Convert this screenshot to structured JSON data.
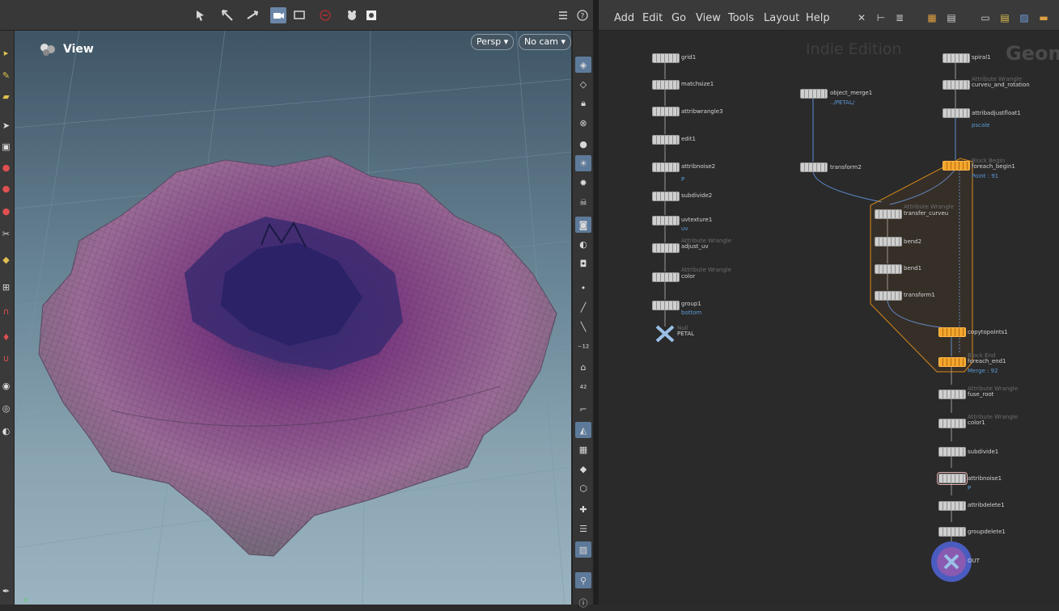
{
  "viewer": {
    "view_label": "View",
    "persp_button": "Persp",
    "cam_button": "No cam",
    "toolbar_icons": [
      "select-mode-icon",
      "handle-icon",
      "transform-icon",
      "camera-icon",
      "display-icon",
      "ghost-icon",
      "snapshot-icon",
      "render-icon"
    ],
    "axis_label": "y"
  },
  "network": {
    "menu": [
      "Add",
      "Edit",
      "Go",
      "View",
      "Tools",
      "Layout",
      "Help"
    ],
    "watermark_edition": "Indie Edition",
    "watermark_context": "Geom",
    "nodes": {
      "grid1": {
        "label": "grid1"
      },
      "matchsize1": {
        "label": "matchsize1"
      },
      "attribwrangle3": {
        "label": "attribwrangle3"
      },
      "edit1": {
        "label": "edit1"
      },
      "attribnoise2": {
        "label": "attribnoise2",
        "extra": "P"
      },
      "subdivide2": {
        "label": "subdivide2"
      },
      "uvtexture1": {
        "label": "uvtexture1",
        "extra": "uv"
      },
      "adjust_uv": {
        "type": "Attribute Wrangle",
        "label": "adjust_uv"
      },
      "color": {
        "type": "Attribute Wrangle",
        "label": "color"
      },
      "group1": {
        "label": "group1",
        "extra": "bottom"
      },
      "petal": {
        "type": "Null",
        "label": "PETAL"
      },
      "object_merge1": {
        "label": "object_merge1",
        "extra": "../PETAL/"
      },
      "transform2": {
        "label": "transform2"
      },
      "spiral1": {
        "label": "spiral1"
      },
      "curveu_and_rotation": {
        "type": "Attribute Wrangle",
        "label": "curveu_and_rotation"
      },
      "attribadjustfloat1": {
        "label": "attribadjustfloat1",
        "extra": "pscale"
      },
      "foreach_begin1": {
        "type": "Block Begin",
        "label": "foreach_begin1",
        "extra": "Point : 91"
      },
      "transfer_curveu": {
        "type": "Attribute Wrangle",
        "label": "transfer_curveu"
      },
      "bend2": {
        "label": "bend2"
      },
      "bend1": {
        "label": "bend1"
      },
      "transform1": {
        "label": "transform1"
      },
      "copytopoints1": {
        "label": "copytopoints1"
      },
      "foreach_end1": {
        "type": "Block End",
        "label": "foreach_end1",
        "extra": "Merge : 92"
      },
      "fuse_root": {
        "type": "Attribute Wrangle",
        "label": "fuse_root"
      },
      "color1": {
        "type": "Attribute Wrangle",
        "label": "color1"
      },
      "subdivide1": {
        "label": "subdivide1"
      },
      "attribnoise1": {
        "label": "attribnoise1",
        "extra": "P"
      },
      "attribdelete1": {
        "label": "attribdelete1"
      },
      "groupdelete1": {
        "label": "groupdelete1"
      },
      "out": {
        "label": "OUT"
      }
    }
  },
  "colors": {
    "accent_blue": "#6a86a8",
    "block_orange": "#f2a62c",
    "link_blue": "#5c9ad6",
    "out_node": "#5a6fd0"
  }
}
